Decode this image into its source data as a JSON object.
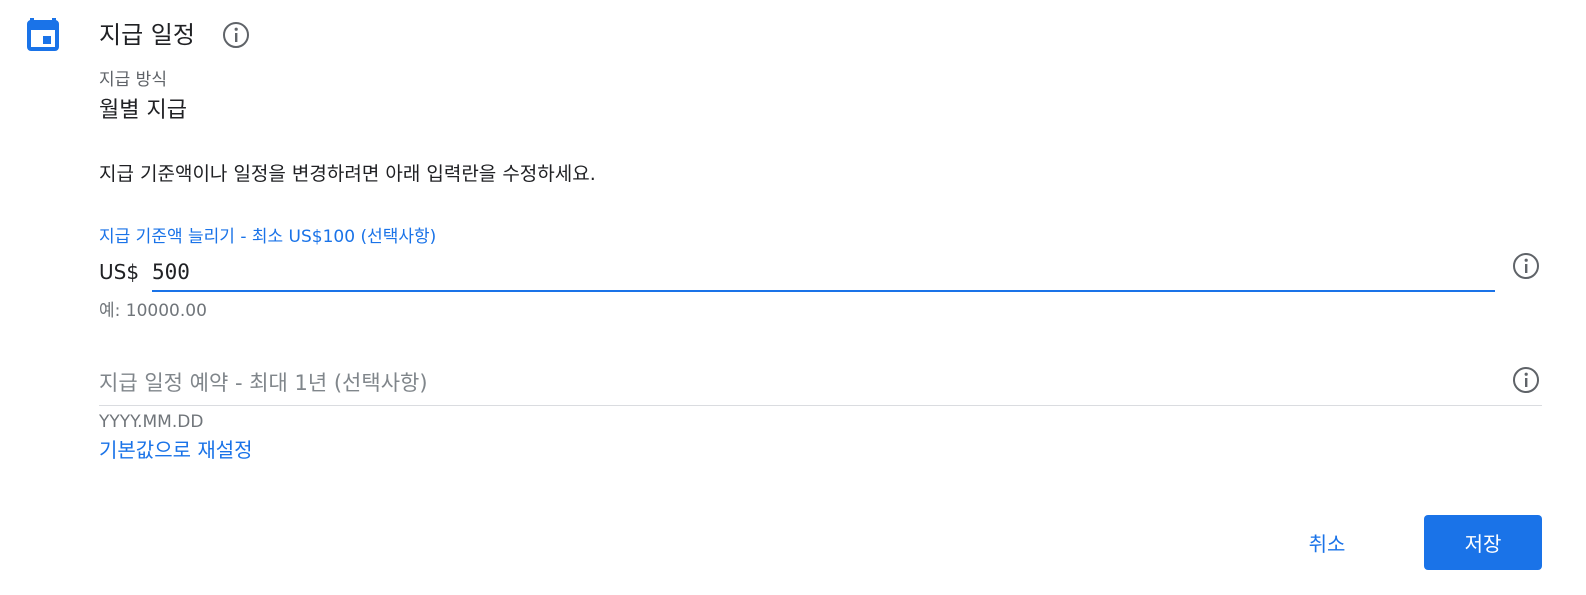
{
  "header": {
    "title": "지급 일정",
    "icon": "calendar-icon",
    "info_icon": "info-icon"
  },
  "payment_method": {
    "label": "지급 방식",
    "value": "월별 지급"
  },
  "description": "지급 기준액이나 일정을 변경하려면 아래 입력란을 수정하세요.",
  "threshold": {
    "label": "지급 기준액 늘리기 - 최소 US$100 (선택사항)",
    "currency": "US$",
    "value": "500",
    "hint": "예: 10000.00",
    "info_icon": "info-icon"
  },
  "schedule": {
    "placeholder": "지급 일정 예약 - 최대 1년 (선택사항)",
    "value": "",
    "hint": "YYYY.MM.DD",
    "reset_label": "기본값으로 재설정",
    "info_icon": "info-icon"
  },
  "footer": {
    "cancel_label": "취소",
    "save_label": "저장"
  },
  "colors": {
    "accent": "#1a73e8",
    "text": "#202124",
    "secondary_text": "#5f6368",
    "divider": "#dadce0"
  }
}
